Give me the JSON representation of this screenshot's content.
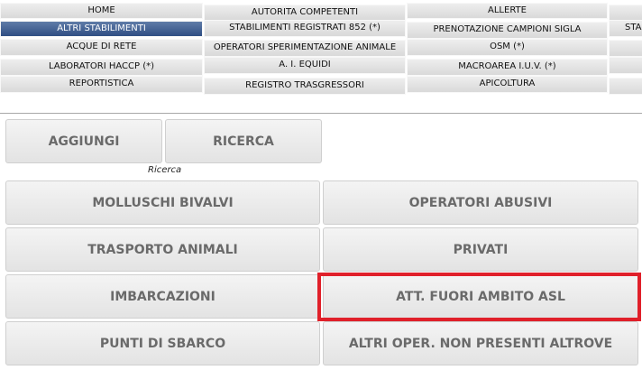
{
  "nav": {
    "rows": [
      [
        "HOME",
        "AUTORITA COMPETENTI",
        "ALLERTE",
        ""
      ],
      [
        "ALTRI STABILIMENTI",
        "STABILIMENTI REGISTRATI 852 (*)",
        "PRENOTAZIONE CAMPIONI SIGLA",
        "STA"
      ],
      [
        "ACQUE DI RETE",
        "OPERATORI SPERIMENTAZIONE ANIMALE",
        "OSM (*)",
        ""
      ],
      [
        "LABORATORI HACCP (*)",
        "A. I. EQUIDI",
        "MACROAREA I.U.V. (*)",
        ""
      ],
      [
        "REPORTISTICA",
        "REGISTRO TRASGRESSORI",
        "APICOLTURA",
        ""
      ]
    ],
    "active": "ALTRI STABILIMENTI"
  },
  "actions": {
    "add_label": "AGGIUNGI",
    "search_label": "RICERCA",
    "search_caption": "Ricerca"
  },
  "menu": {
    "molluschi": "MOLLUSCHI BIVALVI",
    "operatori_abusivi": "OPERATORI ABUSIVI",
    "trasporto_animali": "TRASPORTO ANIMALI",
    "privati": "PRIVATI",
    "imbarcazioni": "IMBARCAZIONI",
    "att_fuori_ambito": "ATT. FUORI AMBITO ASL",
    "punti_sbarco": "PUNTI DI SBARCO",
    "altri_operatori": "ALTRI OPER. NON PRESENTI ALTROVE"
  },
  "colors": {
    "highlight": "#e0202a",
    "active_tab": "#2f4e83"
  }
}
